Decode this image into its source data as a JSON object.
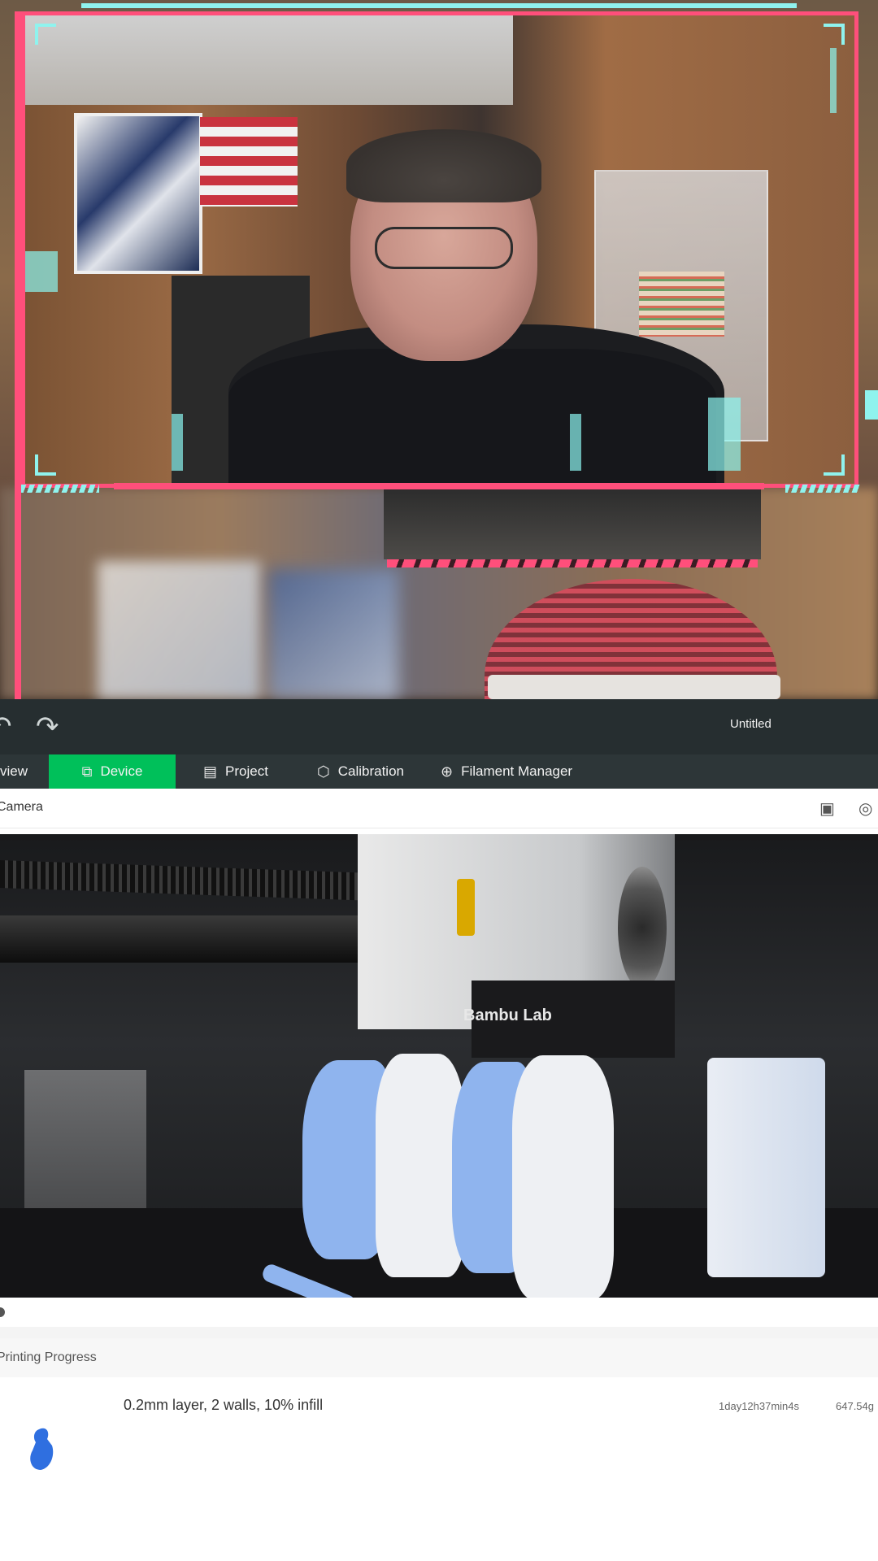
{
  "titlebar": {
    "undo_icon": "undo-arrow",
    "redo_icon": "redo-arrow",
    "title": "Untitled"
  },
  "nav": {
    "tabs": [
      {
        "label": "view",
        "icon": "preview-icon"
      },
      {
        "label": "Device",
        "icon": "device-icon",
        "active": true
      },
      {
        "label": "Project",
        "icon": "project-icon"
      },
      {
        "label": "Calibration",
        "icon": "calibration-icon"
      },
      {
        "label": "Filament Manager",
        "icon": "filament-icon"
      }
    ],
    "active_color": "#00c05a"
  },
  "camera": {
    "header_label": "Camera",
    "icons": [
      "sd-card-icon",
      "recording-icon"
    ]
  },
  "printing_progress": {
    "header_label": "Printing Progress",
    "settings": "0.2mm layer, 2 walls, 10% infill",
    "remaining_time": "1day12h37min4s",
    "weight": "647.54g"
  },
  "printer_view": {
    "brand_text": "Bambu Lab"
  },
  "colors": {
    "frame_pink": "#ff4f7b",
    "hud_cyan": "#8ff3ee",
    "titlebar_bg": "#262e30",
    "nav_bg": "#2d3638"
  }
}
